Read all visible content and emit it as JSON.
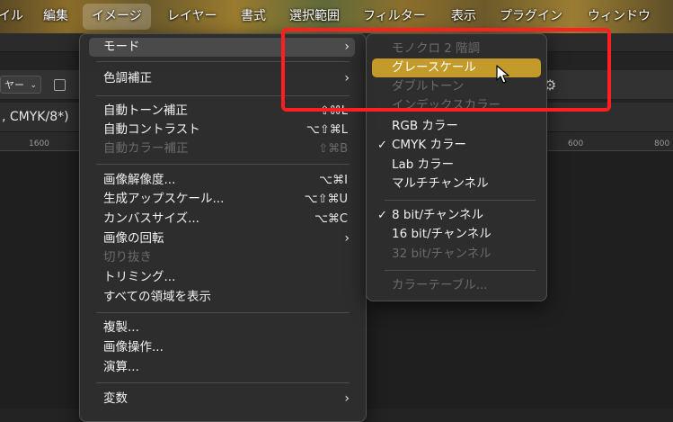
{
  "menubar": {
    "items": [
      "イル",
      "編集",
      "イメージ",
      "レイヤー",
      "書式",
      "選択範囲",
      "フィルター",
      "表示",
      "プラグイン",
      "ウィンドウ"
    ]
  },
  "toolbar": {
    "dropdown_value": "ヤー",
    "dropdown_icon": "chevron-down-icon",
    "settings_icon": "gear-icon"
  },
  "document": {
    "tab_title": ", CMYK/8*)"
  },
  "ruler": {
    "ticks": [
      "1600",
      "600",
      "800"
    ]
  },
  "image_menu": {
    "items": [
      {
        "label": "モード",
        "shortcut": "",
        "submenu": true,
        "disabled": false,
        "highlighted": true
      },
      {
        "label": "色調補正",
        "shortcut": "",
        "submenu": true,
        "disabled": false
      },
      {
        "label": "自動トーン補正",
        "shortcut": "⇧⌘L",
        "submenu": false,
        "disabled": false
      },
      {
        "label": "自動コントラスト",
        "shortcut": "⌥⇧⌘L",
        "submenu": false,
        "disabled": false
      },
      {
        "label": "自動カラー補正",
        "shortcut": "⇧⌘B",
        "submenu": false,
        "disabled": true
      },
      {
        "label": "画像解像度...",
        "shortcut": "⌥⌘I",
        "submenu": false,
        "disabled": false
      },
      {
        "label": "生成アップスケール...",
        "shortcut": "⌥⇧⌘U",
        "submenu": false,
        "disabled": false
      },
      {
        "label": "カンバスサイズ...",
        "shortcut": "⌥⌘C",
        "submenu": false,
        "disabled": false
      },
      {
        "label": "画像の回転",
        "shortcut": "",
        "submenu": true,
        "disabled": false
      },
      {
        "label": "切り抜き",
        "shortcut": "",
        "submenu": false,
        "disabled": true
      },
      {
        "label": "トリミング...",
        "shortcut": "",
        "submenu": false,
        "disabled": false
      },
      {
        "label": "すべての領域を表示",
        "shortcut": "",
        "submenu": false,
        "disabled": false
      },
      {
        "label": "複製...",
        "shortcut": "",
        "submenu": false,
        "disabled": false
      },
      {
        "label": "画像操作...",
        "shortcut": "",
        "submenu": false,
        "disabled": false
      },
      {
        "label": "演算...",
        "shortcut": "",
        "submenu": false,
        "disabled": false
      },
      {
        "label": "変数",
        "shortcut": "",
        "submenu": true,
        "disabled": false
      }
    ],
    "submenu_arrow": "›"
  },
  "mode_submenu": {
    "items": [
      {
        "label": "モノクロ 2 階調",
        "checked": false,
        "disabled": true
      },
      {
        "label": "グレースケール",
        "checked": false,
        "disabled": false,
        "selected": true
      },
      {
        "label": "ダブルトーン",
        "checked": false,
        "disabled": true
      },
      {
        "label": "インデックスカラー",
        "checked": false,
        "disabled": true
      },
      {
        "label": "RGB カラー",
        "checked": false,
        "disabled": false
      },
      {
        "label": "CMYK カラー",
        "checked": true,
        "disabled": false
      },
      {
        "label": "Lab カラー",
        "checked": false,
        "disabled": false
      },
      {
        "label": "マルチチャンネル",
        "checked": false,
        "disabled": false
      },
      {
        "label": "8 bit/チャンネル",
        "checked": true,
        "disabled": false
      },
      {
        "label": "16 bit/チャンネル",
        "checked": false,
        "disabled": false
      },
      {
        "label": "32 bit/チャンネル",
        "checked": false,
        "disabled": true
      },
      {
        "label": "カラーテーブル...",
        "checked": false,
        "disabled": true
      }
    ],
    "check_glyph": "✓"
  },
  "colors": {
    "highlight_gold": "#c49a2a",
    "annotation_red": "#ff1f1f"
  }
}
